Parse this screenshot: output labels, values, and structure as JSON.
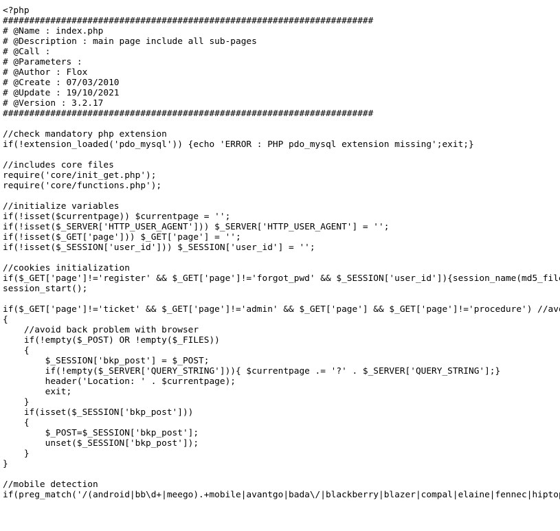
{
  "document": {
    "file_name": "index.php",
    "language": "php",
    "background_color": "#ffffff",
    "text_color": "#000000",
    "clipped_right": true,
    "clipped_bottom": true,
    "header_block": {
      "name": "index.php",
      "description": "main page include all sub-pages",
      "call": "",
      "parameters": "",
      "author": "Flox",
      "create": "07/03/2010",
      "update": "19/10/2021",
      "version": "3.2.17"
    },
    "source": "<?php\n######################################################################\n# @Name : index.php\n# @Description : main page include all sub-pages\n# @Call : \n# @Parameters : \n# @Author : Flox\n# @Create : 07/03/2010\n# @Update : 19/10/2021\n# @Version : 3.2.17\n######################################################################\n\n//check mandatory php extension\nif(!extension_loaded('pdo_mysql')) {echo 'ERROR : PHP pdo_mysql extension missing';exit;}\n\n//includes core files\nrequire('core/init_get.php');\nrequire('core/functions.php');\n\n//initialize variables\nif(!isset($currentpage)) $currentpage = '';\nif(!isset($_SERVER['HTTP_USER_AGENT'])) $_SERVER['HTTP_USER_AGENT'] = '';\nif(!isset($_GET['page'])) $_GET['page'] = '';\nif(!isset($_SESSION['user_id'])) $_SESSION['user_id'] = '';\n\n//cookies initialization\nif($_GET['page']!='register' && $_GET['page']!='forgot_pwd' && $_SESSION['user_id']){session_name(md5_file('connect.php'));}\nsession_start();\n\nif($_GET['page']!='ticket' && $_GET['page']!='admin' && $_GET['page'] && $_GET['page']!='procedure') //avoid upload problem\n{\n    //avoid back problem with browser\n    if(!empty($_POST) OR !empty($_FILES))\n    {\n        $_SESSION['bkp_post'] = $_POST;\n        if(!empty($_SERVER['QUERY_STRING'])){ $currentpage .= '?' . $_SERVER['QUERY_STRING'];}\n        header('Location: ' . $currentpage);\n        exit;\n    }\n    if(isset($_SESSION['bkp_post']))\n    {\n        $_POST=$_SESSION['bkp_post'];\n        unset($_SESSION['bkp_post']);\n    }\n}\n\n//mobile detection\nif(preg_match('/(android|bb\\d+|meego).+mobile|avantgo|bada\\/|blackberry|blazer|compal|elaine|fennec|hiptop|iemobile|ip(hone|od)|iris|kindle|lge |maemo|midp|mmp|mobile.+firefox|netfront|opera m(ob|in)i|palm( os)?|phone|p(ixi|re)\\/|plucker|pocket|psp|series(4|6)0|symbian|treo|up\\.(browser|link)|vodafone|wap|windows (ce|phone)|xda|xiino/i',$_SERVER['HTTP_USER_AGENT'])||preg_match('/1207|6310|6590|3gso|4thp|50[1-6]i|770s|802s|a wa|abac|ac(er|oo|s\\-)|ai(ko|rn)|al(av|ca|co)|amoi|an(ex|ny|yw)|aptu|ar(ch|go)|as(te|us)|attw|au(di|\\-m|r |s )|avan|be(ck|ll|nq)|bi(lb|rd)|bl(ac|az)|br(e|v)w|bumb|bw\\-(n|u)|c55\\/|capi|ccwa|cdm\\-|cell|chtm|cldc|cmd\\-|co(mp|nd)|craw|da(it|ll|ng)|dbte|dc\\-s|devi|dica|dmob|do(c|p)o|ds(12|\\-d)|el(49|ai)|em(l2|ul)|er(ic|k0)|esl8|ez([4-7]0|os|wa|ze)|fetc|fly(\\-|_)|g1 u|g560|gene|gf\\-5|g\\-mo|go(\\.w|od)|gr(ad|un)|haie|hcit|hd\\-(m|p|t)|hei\\-|hi(pt|ta)|hp( i|ip)|hs\\-c|ht(c(\\-| |_|a|g|p|s|t)|tp)|hu(aw|tc)|i\\-(20|go|ma)|i230|iac( |\\-|\\/)|ibro|idea|ig01|ikom|im1k|inno|ipaq|iris|ja(t|v)a|jbro|jemu|jigs|kddi|keji|kgt( |\\/)|klon|kpt |kwc\\-|kyo(c|k)|le(no|xi)|lg( g|\\/(k|l|u)|50|54|\\-[a-w])|libw|lynx|m1\\-w|m3ga|m50\\/|ma(te|ui|xo)|mc(01|21|ca)|m\\-cr|me(rc|ri)|mi(o8|oa|ts)|mmef|mo(01|02|bi|de|do|t(\\-| |o|v)|zz)|mt(50|p1|v )|mwbp|mywa|n10[0-2]|n20[2-3]|n30(0|2)|n50(0|2|5)|n7(0(0|1)|10)|ne((c|m)\\-|on|tf|wf|wg|wt)|nok(6|i)|nzph|o2im|op(ti|wv)|oran|owg1|p800|pan(a|d|t)|pdxg|pg(13|\\-([1-8]|c))|phil|pire|pl(ay|uc)|pn\\-2|po(ck|rt|se)|prox|psio|pt\\-g|qa\\-a|qc(07|12|21|32|60|\\-[2-7]|i\\-)|qtek|r380|r600|raks|rim9|ro(ve|zo)|s55\\/|sa(ge|ma|mm|ms|ny|va)|sc(01|h\\-|oo|p\\-)|sdk\\/|se(c(\\-|0|1)|47|mc|nd|ri)|sgh\\-|shar|sie(\\-|m)|sk\\-0|sl(45|id)|sm(al|ar|b3|it|t5)|so(ft|ny)|sp(01|h\\-|v\\-|v )|sy(01|mb)|t2(18|50)|t6(00|10|18)|ta(gt|lk)|tcl\\-|tdg\\-|tel(i|m)|tim\\-|t\\-mo|to(pl|sh)|ts(70|m\\-|m3|m5)|tx\\-9|up(\\.b|g1|si)|utst|v400|v750|veri|vi(rg|te)|vk(40|5[0-3]|\\-v)|vm40|voda|vulc|vx(52|53|60|61|70|80|81|83|85|98)|w3c(\\-| )|webc|whit|wi(g |nc|nw)|wmlb|wonu|x700|yas\\-|your|zeto|zte\\-/i',substr($_SERVER['HTTP_USER_AGENT'],0,4)))\n"
  }
}
